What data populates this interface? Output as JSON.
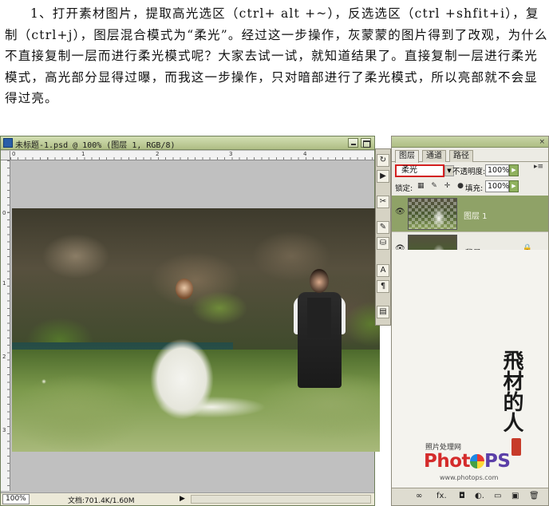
{
  "instructions": {
    "text": "1、打开素材图片，提取高光选区（ctrl+ alt +~），反选选区（ctrl +shfit+i），复制（ctrl+j），图层混合模式为“柔光”。经过这一步操作，灰蒙蒙的图片得到了改观，为什么不直接复制一层而进行柔光模式呢？大家去试一试，就知道结果了。直接复制一层进行柔光模式，高光部分显得过曝，而我这一步操作，只对暗部进行了柔光模式，所以亮部就不会显得过亮。"
  },
  "document": {
    "title": "未标题-1.psd @ 100% (图层 1, RGB/8)",
    "ruler_top": [
      "0",
      "1",
      "2",
      "3",
      "4"
    ],
    "ruler_left": [
      "0",
      "1",
      "2",
      "3"
    ],
    "zoom": "100%",
    "doc_info": "文档:701.4K/1.60M",
    "status_arrow": "▶"
  },
  "tools": {
    "icons": [
      "history-icon",
      "actions-icon",
      "tools-icon",
      "brush-preset-icon",
      "clone-source-icon",
      "character-icon",
      "paragraph-icon",
      "layer-comps-icon"
    ],
    "glyphs": [
      "↻",
      "▶",
      "✂",
      "✎",
      "⛁",
      "A",
      "¶",
      "▤"
    ]
  },
  "panel": {
    "tabs": [
      "图层",
      "通道",
      "路径"
    ],
    "close_glyph": "×",
    "menu_glyph": "▸≡",
    "blend_mode": "柔光",
    "opacity_label": "不透明度:",
    "opacity_value": "100%",
    "lock_label": "锁定:",
    "lock_icons": "▦ ✎ ✛ ●",
    "fill_label": "填充:",
    "fill_value": "100%",
    "arrow_glyph": "▶",
    "dropdown_glyph": "▼",
    "layers": [
      {
        "name": "图层 1",
        "visible": true,
        "selected": true,
        "eye": "👁"
      },
      {
        "name": "背景",
        "visible": true,
        "selected": false,
        "eye": "👁",
        "lock": "🔒"
      }
    ],
    "watermark": {
      "calligraphy": "飛材的人",
      "brand_sub": "照片处理网",
      "brand_pre": "Phot",
      "brand_post": "PS",
      "brand_url": "www.photops.com"
    },
    "footer_buttons": [
      "∞",
      "fx.",
      "◘",
      "◐.",
      "▭",
      "▣",
      "🗑"
    ]
  },
  "colors": {
    "titlebar_green": "#aebd84",
    "selected_layer": "#8fa267",
    "highlight_box": "#d32020",
    "brand_red": "#d42b2b"
  }
}
